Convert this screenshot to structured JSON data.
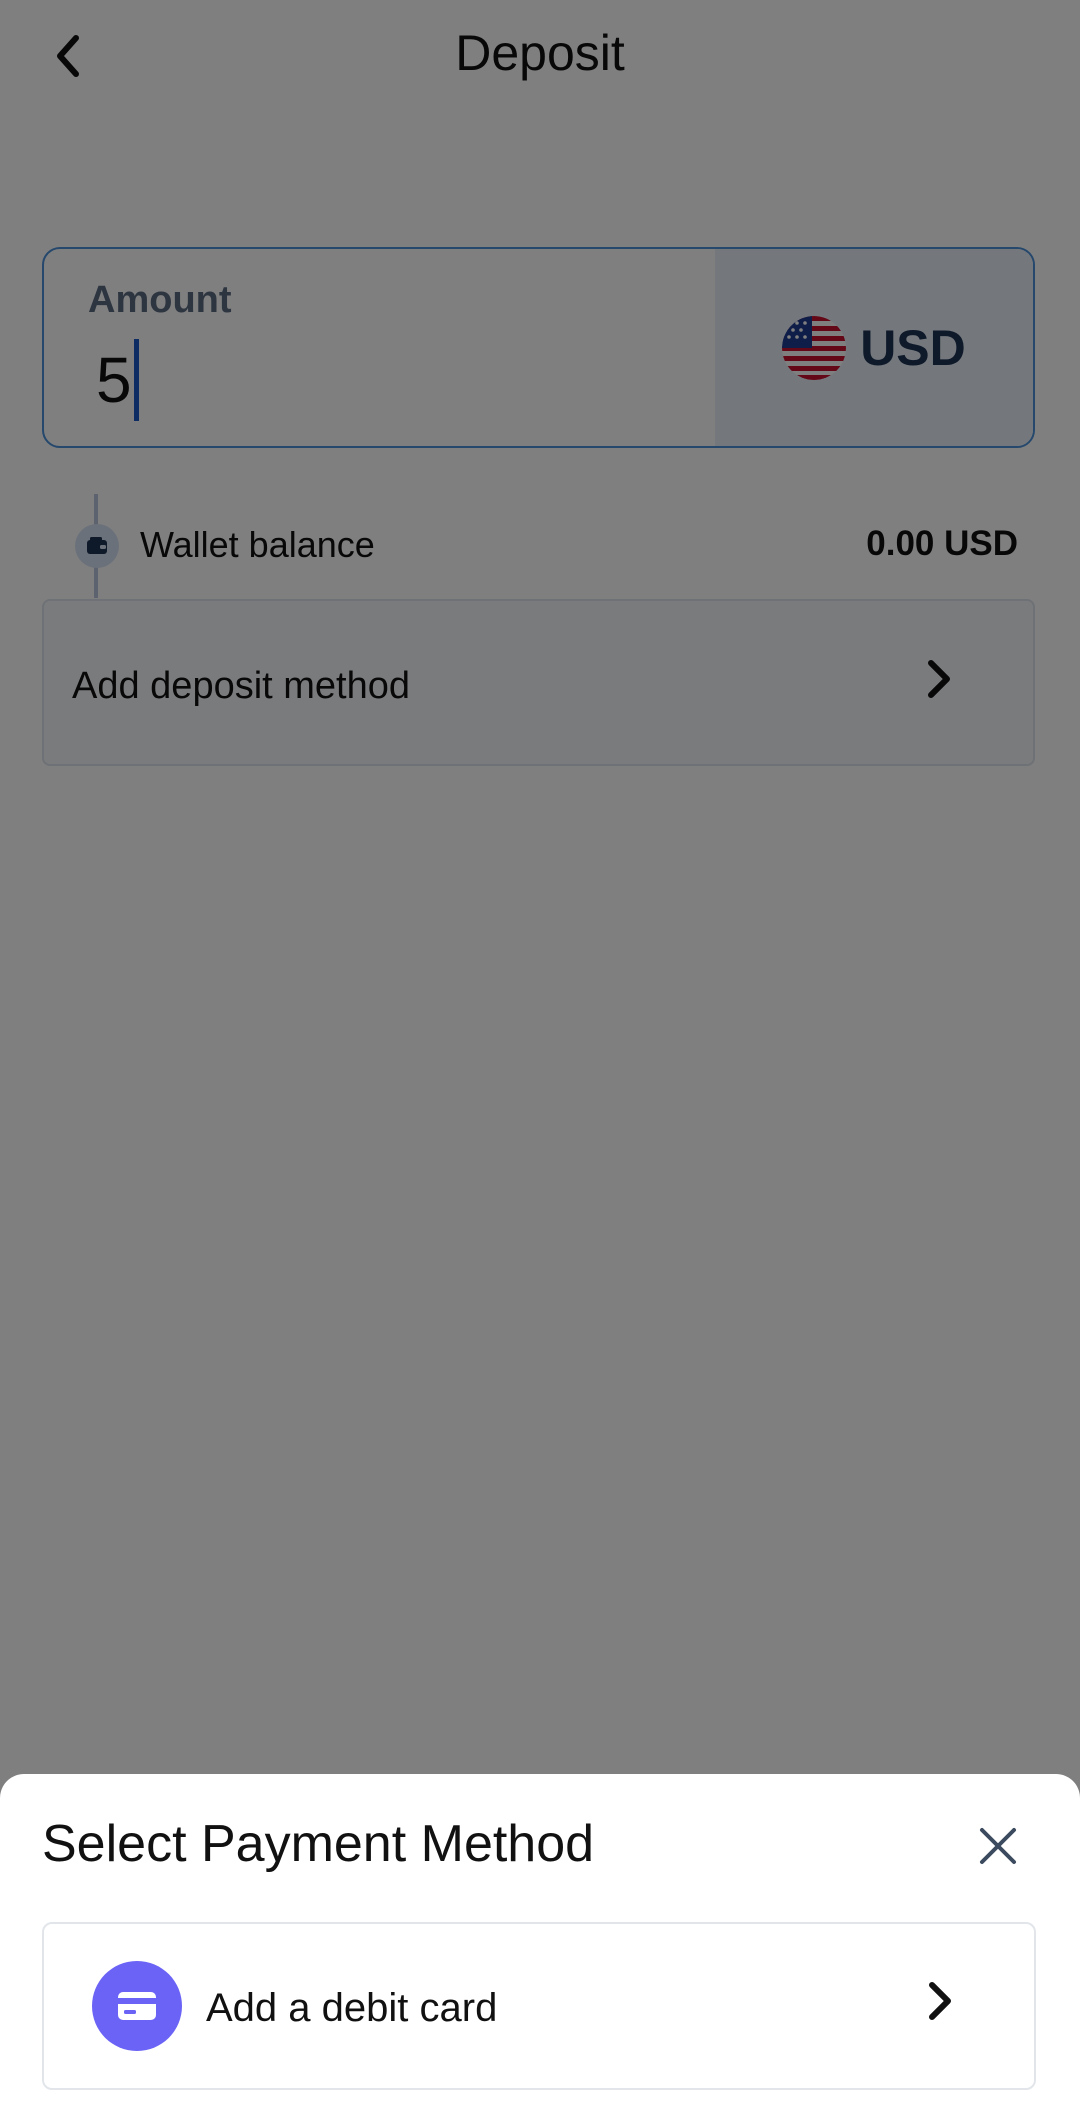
{
  "header": {
    "title": "Deposit",
    "back_icon": "chevron-left-icon"
  },
  "amount": {
    "label": "Amount",
    "value": "5",
    "currency": "USD",
    "flag_icon": "us-flag-icon"
  },
  "wallet": {
    "label": "Wallet balance",
    "value": "0.00 USD",
    "icon": "wallet-icon"
  },
  "deposit_method": {
    "label": "Add deposit method",
    "icon": "chevron-right-icon"
  },
  "sheet": {
    "title": "Select Payment Method",
    "close_icon": "close-icon",
    "options": [
      {
        "label": "Add a debit card",
        "icon": "credit-card-icon"
      }
    ]
  },
  "colors": {
    "accent": "#1b58c7",
    "card_icon_bg": "#6b63f6",
    "currency_bg": "#e9f0fb",
    "currency_text": "#1d3354"
  }
}
